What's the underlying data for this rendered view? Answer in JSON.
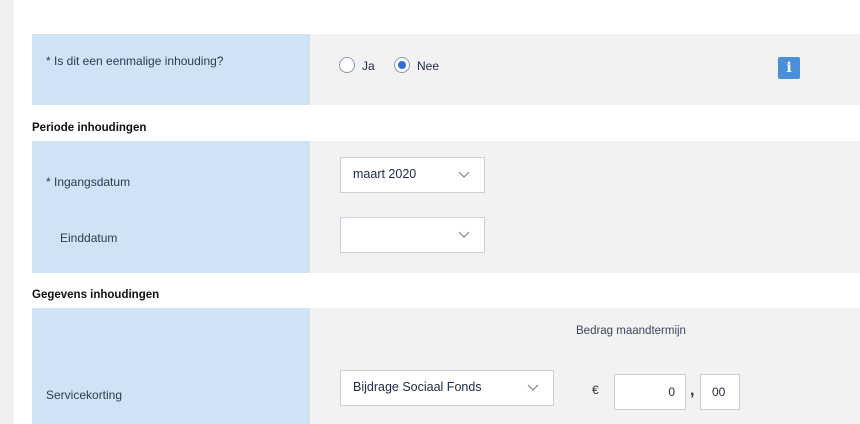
{
  "eenmalig": {
    "label": "*  Is dit een eenmalige inhouding?",
    "options": [
      "Ja",
      "Nee"
    ],
    "selected": "Nee",
    "info_label": "i"
  },
  "periode": {
    "title": "Periode inhoudingen",
    "ingangsdatum": {
      "label": "*  Ingangsdatum",
      "value": "maart 2020"
    },
    "einddatum": {
      "label": "Einddatum",
      "value": ""
    }
  },
  "gegevens": {
    "title": "Gegevens inhoudingen",
    "bedrag_header": "Bedrag maandtermijn",
    "servicekorting": {
      "label": "Servicekorting",
      "fonds": "Bijdrage Sociaal Fonds",
      "currency": "€",
      "euros": "0",
      "separator": ",",
      "cents": "00"
    }
  },
  "icons": {
    "dropdown": "chevron-down-icon",
    "info": "info-icon"
  },
  "colors": {
    "label_bg": "#cfe3f5",
    "value_bg": "#f2f2f2",
    "accent": "#4a90d9",
    "radio_checked": "#2d6fd6"
  }
}
